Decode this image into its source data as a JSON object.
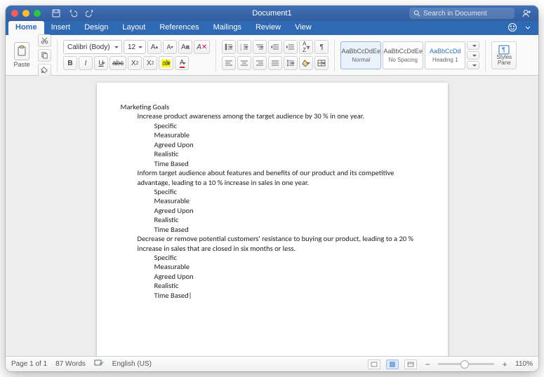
{
  "title": "Document1",
  "search": {
    "placeholder": "Search in Document"
  },
  "tabs": [
    "Home",
    "Insert",
    "Design",
    "Layout",
    "References",
    "Mailings",
    "Review",
    "View"
  ],
  "active_tab": 0,
  "ribbon": {
    "paste_label": "Paste",
    "font_name": "Calibri (Body)",
    "font_size": "12",
    "styles": [
      {
        "sample": "AaBbCcDdEe",
        "name": "Normal",
        "selected": true
      },
      {
        "sample": "AaBbCcDdEe",
        "name": "No Spacing",
        "selected": false
      },
      {
        "sample": "AaBbCcDd",
        "name": "Heading 1",
        "selected": false
      }
    ],
    "styles_pane_label": "Styles\nPane"
  },
  "document": {
    "heading": "Marketing Goals",
    "goals": [
      {
        "text": "Increase product awareness among the target audience by 30 % in one year.",
        "criteria": [
          "Specific",
          "Measurable",
          "Agreed Upon",
          "Realistic",
          "Time Based"
        ]
      },
      {
        "text": "Inform target audience about features and benefits of our product and its competitive advantage, leading to a 10 % increase in sales in one year.",
        "criteria": [
          "Specific",
          "Measurable",
          "Agreed Upon",
          "Realistic",
          "Time Based"
        ]
      },
      {
        "text": "Decrease or remove potential customers' resistance to buying our product, leading to a 20 % increase in sales that are closed in six months or less.",
        "criteria": [
          "Specific",
          "Measurable",
          "Agreed Upon",
          "Realistic",
          "Time Based"
        ]
      }
    ]
  },
  "status": {
    "page": "Page 1 of 1",
    "words": "87 Words",
    "language": "English (US)",
    "zoom": "110%"
  }
}
